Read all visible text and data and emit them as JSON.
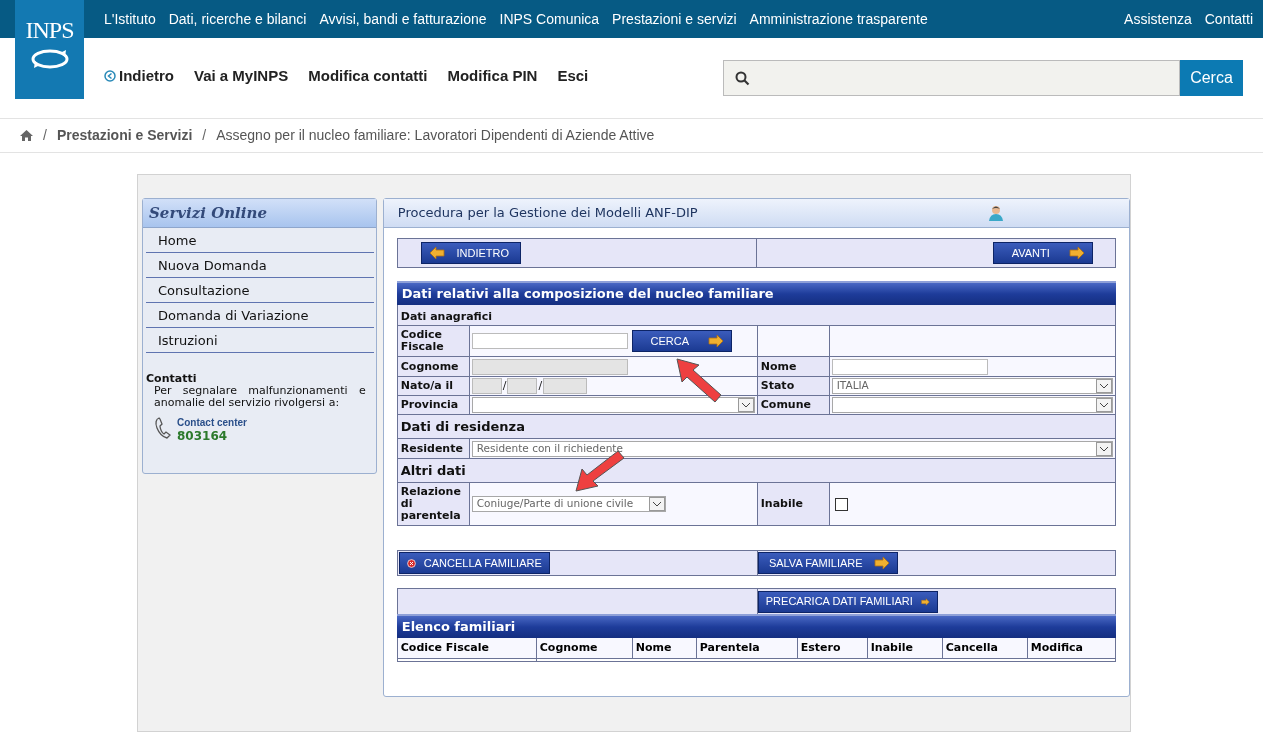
{
  "top_nav": {
    "links": [
      "L'Istituto",
      "Dati, ricerche e bilanci",
      "Avvisi, bandi e fatturazione",
      "INPS Comunica",
      "Prestazioni e servizi",
      "Amministrazione trasparente"
    ],
    "right_links": [
      "Assistenza",
      "Contatti"
    ]
  },
  "header": {
    "logo": "INPS",
    "actions": [
      {
        "label": "Indietro",
        "kind": "back"
      },
      {
        "label": "Vai a MyINPS",
        "kind": "link"
      },
      {
        "label": "Modifica contatti",
        "kind": "link"
      },
      {
        "label": "Modifica PIN",
        "kind": "link"
      },
      {
        "label": "Esci",
        "kind": "link"
      }
    ],
    "search_button": "Cerca"
  },
  "breadcrumb": {
    "separator": "/",
    "items": [
      {
        "label": "Prestazioni e Servizi",
        "kind": "link"
      },
      {
        "label": "Assegno per il nucleo familiare: Lavoratori Dipendenti di Aziende Attive",
        "kind": "current"
      }
    ]
  },
  "sidebar": {
    "title": "Servizi Online",
    "items": [
      "Home",
      "Nuova Domanda",
      "Consultazione",
      "Domanda di Variazione",
      "Istruzioni"
    ],
    "contacts_title": "Contatti",
    "contacts_text": "Per segnalare malfunzionamenti e anomalie del servizio rivolgersi a:",
    "contact_label": "Contact center",
    "contact_number": "803164"
  },
  "main": {
    "title": "Procedura per la Gestione dei Modelli ANF-DIP",
    "nav_buttons": [
      {
        "label": "INDIETRO",
        "kind": "back"
      },
      {
        "label": "AVANTI",
        "kind": "forward"
      }
    ],
    "section_title": "Dati relativi alla composizione del nucleo familiare",
    "anagrafici": {
      "title": "Dati anagrafici",
      "codice_fiscale": {
        "label": "Codice Fiscale",
        "disabled": false,
        "button": "CERCA"
      },
      "cognome": {
        "label": "Cognome",
        "disabled": true
      },
      "nome": {
        "label": "Nome",
        "disabled": false
      },
      "nato": {
        "label": "Nato/a il",
        "separators": [
          "/",
          "/"
        ]
      },
      "stato": {
        "label": "Stato",
        "value": "ITALIA"
      },
      "provincia": {
        "label": "Provincia"
      },
      "comune": {
        "label": "Comune"
      }
    },
    "residenza": {
      "title": "Dati di residenza",
      "label": "Residente",
      "value": "Residente con il richiedente"
    },
    "altri": {
      "title": "Altri dati",
      "relazione_label": "Relazione di parentela",
      "relazione_value": "Coniuge/Parte di unione civile",
      "inabile_label": "Inabile",
      "inabile_checked": false
    },
    "actions": [
      {
        "label": "CANCELLA FAMILIARE",
        "kind": "delete"
      },
      {
        "label": "SALVA FAMILIARE",
        "kind": "forward"
      }
    ],
    "preload_button": "PRECARICA DATI FAMILIARI",
    "familiari": {
      "title": "Elenco familiari",
      "columns": [
        "Codice Fiscale",
        "Cognome",
        "Nome",
        "Parentela",
        "Estero",
        "Inabile",
        "Cancella",
        "Modifica"
      ]
    }
  }
}
